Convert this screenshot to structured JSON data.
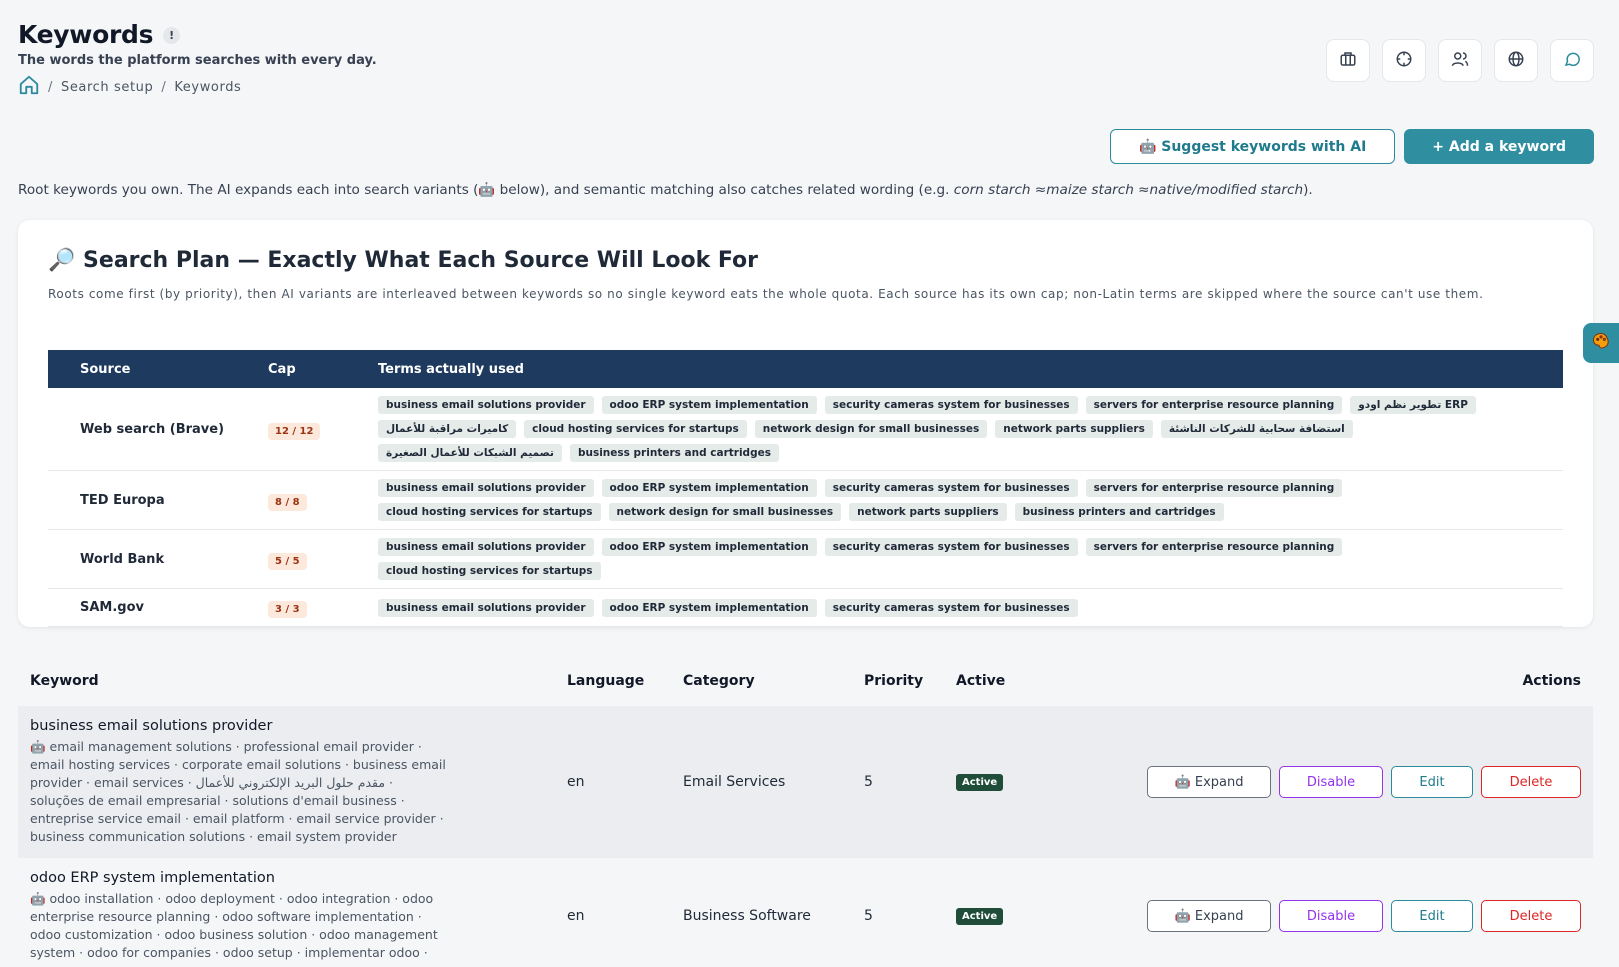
{
  "header": {
    "title": "Keywords",
    "info_glyph": "!",
    "subtitle": "The words the platform searches with every day.",
    "breadcrumb": [
      "Search setup",
      "Keywords"
    ]
  },
  "top_icons": [
    "briefcase-icon",
    "crosshair-icon",
    "users-icon",
    "globe-icon",
    "chat-icon"
  ],
  "actions": {
    "suggest_label": "🤖 Suggest keywords with AI",
    "add_label": "+ Add a keyword"
  },
  "intro": {
    "prefix": "Root keywords you own. The AI expands each into search variants (🤖 below), and semantic matching also catches related wording (e.g. ",
    "example": "corn starch ≈maize starch ≈native/modified starch",
    "suffix": ")."
  },
  "plan": {
    "title": "🔎 Search Plan — Exactly What Each Source Will Look For",
    "description": "Roots come first (by priority), then AI variants are interleaved between keywords so no single keyword eats the whole quota. Each source has its own cap; non-Latin terms are skipped where the source can't use them.",
    "columns": [
      "Source",
      "Cap",
      "Terms actually used"
    ],
    "rows": [
      {
        "source": "Web search (Brave)",
        "cap": "12 / 12",
        "terms": [
          "business email solutions provider",
          "odoo ERP system implementation",
          "security cameras system for businesses",
          "servers for enterprise resource planning",
          "تطوير نظم اودو ERP",
          "كاميرات مراقبة للأعمال",
          "cloud hosting services for startups",
          "network design for small businesses",
          "network parts suppliers",
          "استضافة سحابية للشركات الناشئة",
          "تصميم الشبكات للأعمال الصغيرة",
          "business printers and cartridges"
        ]
      },
      {
        "source": "TED Europa",
        "cap": "8 / 8",
        "terms": [
          "business email solutions provider",
          "odoo ERP system implementation",
          "security cameras system for businesses",
          "servers for enterprise resource planning",
          "cloud hosting services for startups",
          "network design for small businesses",
          "network parts suppliers",
          "business printers and cartridges"
        ]
      },
      {
        "source": "World Bank",
        "cap": "5 / 5",
        "terms": [
          "business email solutions provider",
          "odoo ERP system implementation",
          "security cameras system for businesses",
          "servers for enterprise resource planning",
          "cloud hosting services for startups"
        ]
      },
      {
        "source": "SAM.gov",
        "cap": "3 / 3",
        "terms": [
          "business email solutions provider",
          "odoo ERP system implementation",
          "security cameras system for businesses"
        ]
      }
    ]
  },
  "keywords": {
    "columns": [
      "Keyword",
      "Language",
      "Category",
      "Priority",
      "Active",
      "Actions"
    ],
    "rows": [
      {
        "name": "business email solutions provider",
        "variants": "🤖 email management solutions · professional email provider · email hosting services · corporate email solutions · business email provider · email services · مقدم حلول البريد الإلكتروني للأعمال · soluções de email empresarial · solutions d'email business · entreprise service email · email platform · email service provider · business communication solutions · email system provider",
        "language": "en",
        "category": "Email Services",
        "priority": "5",
        "status": "Active"
      },
      {
        "name": "odoo ERP system implementation",
        "variants": "🤖 odoo installation · odoo deployment · odoo integration · odoo enterprise resource planning · odoo software implementation · odoo customization · odoo business solution · odoo management system · odoo for companies · odoo setup · implementar odoo ·",
        "language": "en",
        "category": "Business Software",
        "priority": "5",
        "status": "Active"
      }
    ],
    "buttons": {
      "expand": "🤖 Expand",
      "disable": "Disable",
      "edit": "Edit",
      "delete": "Delete"
    }
  },
  "side_tab_icon": "palette-icon",
  "colors": {
    "accent": "#2f8fa0",
    "header_band": "#1e3a5f",
    "active_badge": "#1f4d3a",
    "disable": "#9333ea",
    "delete": "#dc2626",
    "cap_badge": "#fde8dc"
  }
}
